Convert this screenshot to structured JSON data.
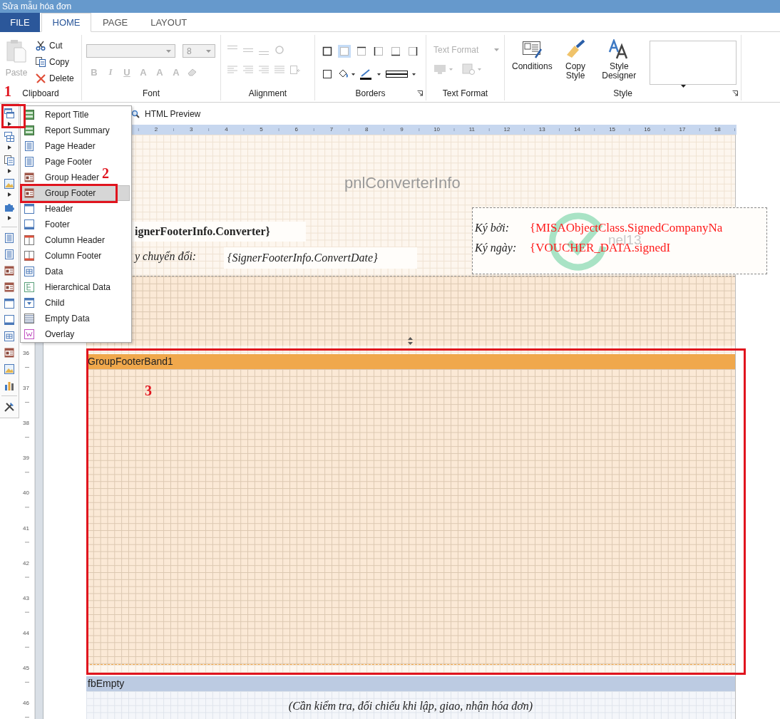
{
  "window": {
    "title": "Sửa mẫu hóa đơn"
  },
  "ribbon_tabs": [
    {
      "label": "FILE",
      "kind": "file",
      "selected": false
    },
    {
      "label": "HOME",
      "kind": "tab",
      "selected": true
    },
    {
      "label": "PAGE",
      "kind": "tab",
      "selected": false
    },
    {
      "label": "LAYOUT",
      "kind": "tab",
      "selected": false
    }
  ],
  "ribbon": {
    "clipboard": {
      "label": "Clipboard",
      "paste": {
        "label": "Paste",
        "disabled": true
      },
      "actions": [
        "Cut",
        "Copy",
        "Delete"
      ]
    },
    "font": {
      "label": "Font",
      "size": "8",
      "format_buttons": [
        "B",
        "I",
        "U",
        "A",
        "A",
        "A"
      ]
    },
    "alignment": {
      "label": "Alignment"
    },
    "borders": {
      "label": "Borders"
    },
    "text_format": {
      "label": "Text Format",
      "placeholder": "Text Format",
      "disabled": true
    },
    "style": {
      "label": "Style",
      "buttons": [
        "Conditions",
        "Copy Style",
        "Style Designer"
      ]
    }
  },
  "document_toolbar": {
    "html_preview": "HTML Preview"
  },
  "insert_menu": {
    "items": [
      {
        "label": "Report Title",
        "selected": false
      },
      {
        "label": "Report Summary",
        "selected": false
      },
      {
        "label": "Page Header",
        "selected": false
      },
      {
        "label": "Page Footer",
        "selected": false
      },
      {
        "label": "Group Header",
        "selected": false
      },
      {
        "label": "Group Footer",
        "selected": true
      },
      {
        "label": "Header",
        "selected": false
      },
      {
        "label": "Footer",
        "selected": false
      },
      {
        "label": "Column Header",
        "selected": false
      },
      {
        "label": "Column Footer",
        "selected": false
      },
      {
        "label": "Data",
        "selected": false
      },
      {
        "label": "Hierarchical Data",
        "selected": false
      },
      {
        "label": "Child",
        "selected": false
      },
      {
        "label": "Empty Data",
        "selected": false
      },
      {
        "label": "Overlay",
        "selected": false
      }
    ]
  },
  "rulers": {
    "horizontal": [
      "2",
      "3",
      "4",
      "5",
      "6",
      "7",
      "8",
      "9",
      "10",
      "11",
      "12",
      "13",
      "14",
      "15",
      "16",
      "17",
      "18"
    ],
    "vertical": [
      "36",
      "37",
      "38",
      "39",
      "40",
      "41",
      "42",
      "43",
      "44",
      "45",
      "46"
    ]
  },
  "design": {
    "panel_label": "pnlConverterInfo",
    "converter_field": "ignerFooterInfo.Converter}",
    "convert_date_label": "y chuyển đổi:",
    "convert_date_field": "{SignerFooterInfo.ConvertDate}",
    "signature": {
      "signed_by_label": "Ký bởi:",
      "signed_by_value": "{MISAObjectClass.SignedCompanyNa",
      "signed_date_label": "Ký ngày:",
      "signed_date_value": "{VOUCHER_DATA.signedI",
      "overlay_text": "nel13"
    }
  },
  "bands": [
    {
      "name": "GroupFooterBand1",
      "kind": "group_footer"
    },
    {
      "name": "fbEmpty",
      "kind": "empty_data",
      "note": "(Cần kiểm tra, đối chiếu khi lập, giao, nhận hóa đơn)"
    }
  ],
  "annotations": [
    {
      "label": "1"
    },
    {
      "label": "2"
    },
    {
      "label": "3"
    }
  ]
}
